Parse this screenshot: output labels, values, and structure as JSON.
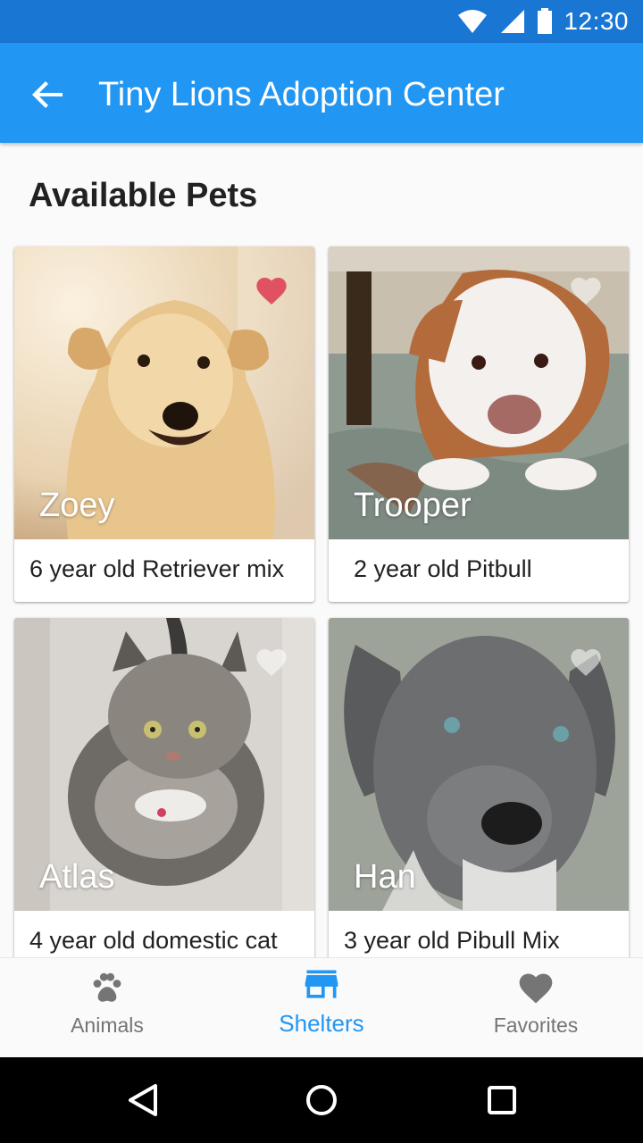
{
  "status_bar": {
    "time": "12:30",
    "icons": [
      "wifi-icon",
      "signal-icon",
      "battery-icon"
    ]
  },
  "app_bar": {
    "title": "Tiny Lions Adoption Center",
    "back_icon": "arrow-back-icon"
  },
  "section_title": "Available Pets",
  "pets": [
    {
      "name": "Zoey",
      "description": "6 year old Retriever mix",
      "favorited": true
    },
    {
      "name": "Trooper",
      "description": "2 year old Pitbull",
      "favorited": false
    },
    {
      "name": "Atlas",
      "description": "4 year old domestic cat",
      "favorited": false
    },
    {
      "name": "Han",
      "description": "3 year old Pibull Mix",
      "favorited": false
    }
  ],
  "bottom_nav": {
    "items": [
      {
        "label": "Animals",
        "icon": "paw-icon",
        "active": false
      },
      {
        "label": "Shelters",
        "icon": "store-icon",
        "active": true
      },
      {
        "label": "Favorites",
        "icon": "heart-icon",
        "active": false
      }
    ]
  },
  "system_nav": {
    "icons": [
      "back-triangle-icon",
      "home-circle-icon",
      "recents-square-icon"
    ]
  },
  "colors": {
    "primary": "#2196F3",
    "primary_dark": "#1976D2",
    "favorite": "#E05262",
    "inactive": "#757575"
  }
}
